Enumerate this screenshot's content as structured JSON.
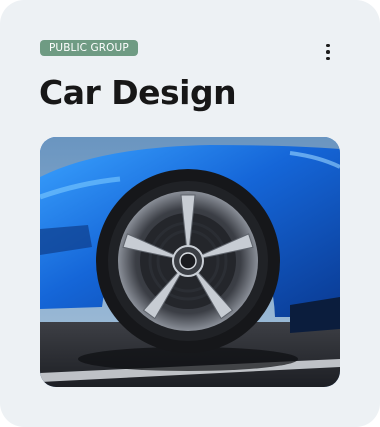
{
  "group": {
    "visibility_label": "PUBLIC GROUP",
    "title": "Car Design",
    "menu_icon": "more-vertical-icon",
    "cover_image": "car-wheel-photo"
  },
  "colors": {
    "card_background": "#edf1f4",
    "badge_background": "#6f9b83",
    "title_text": "#171717",
    "car_paint": "#1e6fd6"
  }
}
